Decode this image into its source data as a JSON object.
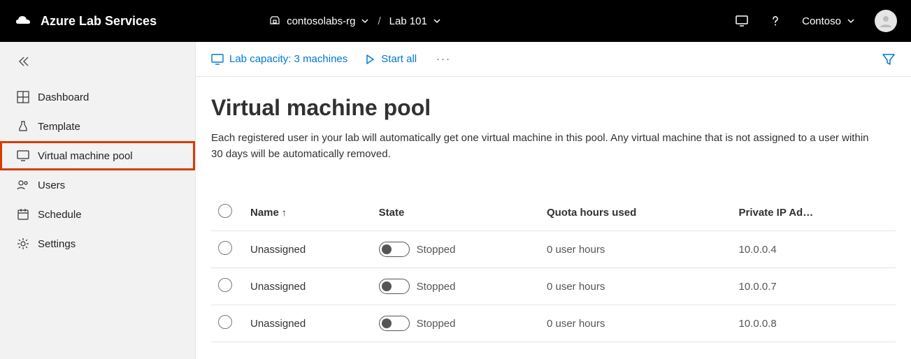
{
  "brand": {
    "name": "Azure Lab Services"
  },
  "breadcrumbs": {
    "rg": "contosolabs-rg",
    "lab": "Lab 101"
  },
  "user": {
    "org": "Contoso"
  },
  "sidebar": {
    "items": [
      {
        "label": "Dashboard"
      },
      {
        "label": "Template"
      },
      {
        "label": "Virtual machine pool"
      },
      {
        "label": "Users"
      },
      {
        "label": "Schedule"
      },
      {
        "label": "Settings"
      }
    ]
  },
  "commands": {
    "capacity": "Lab capacity: 3 machines",
    "start_all": "Start all"
  },
  "page": {
    "title": "Virtual machine pool",
    "description": "Each registered user in your lab will automatically get one virtual machine in this pool. Any virtual machine that is not assigned to a user within 30 days will be automatically removed."
  },
  "table": {
    "columns": {
      "name": "Name",
      "state": "State",
      "quota": "Quota hours used",
      "ip": "Private IP Ad…"
    },
    "rows": [
      {
        "name": "Unassigned",
        "state": "Stopped",
        "quota": "0 user hours",
        "ip": "10.0.0.4"
      },
      {
        "name": "Unassigned",
        "state": "Stopped",
        "quota": "0 user hours",
        "ip": "10.0.0.7"
      },
      {
        "name": "Unassigned",
        "state": "Stopped",
        "quota": "0 user hours",
        "ip": "10.0.0.8"
      }
    ]
  }
}
